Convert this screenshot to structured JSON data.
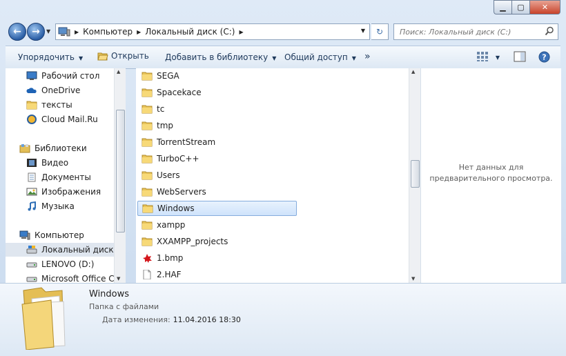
{
  "address": {
    "crumbs": [
      "Компьютер",
      "Локальный диск (C:)"
    ]
  },
  "search": {
    "placeholder": "Поиск: Локальный диск (C:)"
  },
  "toolbar": {
    "organize": "Упорядочить",
    "open": "Открыть",
    "add_to_library": "Добавить в библиотеку",
    "share": "Общий доступ",
    "more": "»"
  },
  "nav_pane": {
    "items": [
      {
        "label": "Рабочий стол",
        "icon": "desktop-icon"
      },
      {
        "label": "OneDrive",
        "icon": "onedrive-icon"
      },
      {
        "label": "тексты",
        "icon": "folder-icon"
      },
      {
        "label": "Cloud Mail.Ru",
        "icon": "cloud-icon"
      },
      {
        "label": "Библиотеки",
        "icon": "libraries-icon"
      },
      {
        "label": "Видео",
        "icon": "video-icon"
      },
      {
        "label": "Документы",
        "icon": "documents-icon"
      },
      {
        "label": "Изображения",
        "icon": "pictures-icon"
      },
      {
        "label": "Музыка",
        "icon": "music-icon"
      },
      {
        "label": "Компьютер",
        "icon": "computer-icon"
      },
      {
        "label": "Локальный диск (C:)",
        "icon": "drive-icon"
      },
      {
        "label": "LENOVO (D:)",
        "icon": "drive-icon"
      },
      {
        "label": "Microsoft Office Click-to-Run",
        "icon": "drive-icon"
      }
    ],
    "selected": "Локальный диск (C:)"
  },
  "files": {
    "items": [
      {
        "name": "SEGA",
        "type": "folder"
      },
      {
        "name": "Spacekace",
        "type": "folder"
      },
      {
        "name": "tc",
        "type": "folder"
      },
      {
        "name": "tmp",
        "type": "folder"
      },
      {
        "name": "TorrentStream",
        "type": "folder"
      },
      {
        "name": "TurboC++",
        "type": "folder"
      },
      {
        "name": "Users",
        "type": "folder"
      },
      {
        "name": "WebServers",
        "type": "folder"
      },
      {
        "name": "Windows",
        "type": "folder"
      },
      {
        "name": "xampp",
        "type": "folder"
      },
      {
        "name": "XXAMPP_projects",
        "type": "folder"
      },
      {
        "name": "1.bmp",
        "type": "bmp"
      },
      {
        "name": "2.HAF",
        "type": "file"
      }
    ],
    "selected": "Windows"
  },
  "preview": {
    "message": "Нет данных для предварительного просмотра."
  },
  "details": {
    "name": "Windows",
    "type": "Папка с файлами",
    "modified_label": "Дата изменения:",
    "modified_value": "11.04.2016 18:30"
  },
  "colors": {
    "selection": "#cfe3fb",
    "selection_border": "#84acdd",
    "folder": "#f2cf67",
    "toolbar_text": "#1e395b"
  }
}
